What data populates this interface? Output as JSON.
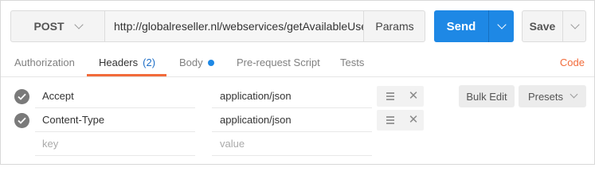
{
  "request": {
    "method": "POST",
    "url": "http://globalreseller.nl/webservices/getAvailableUsers",
    "params_label": "Params",
    "send_label": "Send",
    "save_label": "Save"
  },
  "tabs": [
    {
      "label": "Authorization"
    },
    {
      "label": "Headers",
      "count": "(2)"
    },
    {
      "label": "Body"
    },
    {
      "label": "Pre-request Script"
    },
    {
      "label": "Tests"
    }
  ],
  "code_label": "Code",
  "headers": [
    {
      "key": "Accept",
      "value": "application/json",
      "enabled": true
    },
    {
      "key": "Content-Type",
      "value": "application/json",
      "enabled": true
    }
  ],
  "new_row": {
    "key_placeholder": "key",
    "value_placeholder": "value"
  },
  "bulk_edit_label": "Bulk Edit",
  "presets_label": "Presets",
  "colors": {
    "accent": "#1e88e5",
    "active_tab": "#f26b3a",
    "check": "#7a7a7a"
  },
  "icons": {
    "method_dropdown": "chevron-down-icon",
    "send_dropdown": "chevron-down-icon",
    "save_dropdown": "chevron-down-icon",
    "row_enabled": "check-circle-icon",
    "row_drag": "drag-handle-icon",
    "row_delete": "close-icon",
    "presets_dropdown": "chevron-down-icon",
    "body_indicator": "dot-icon"
  }
}
